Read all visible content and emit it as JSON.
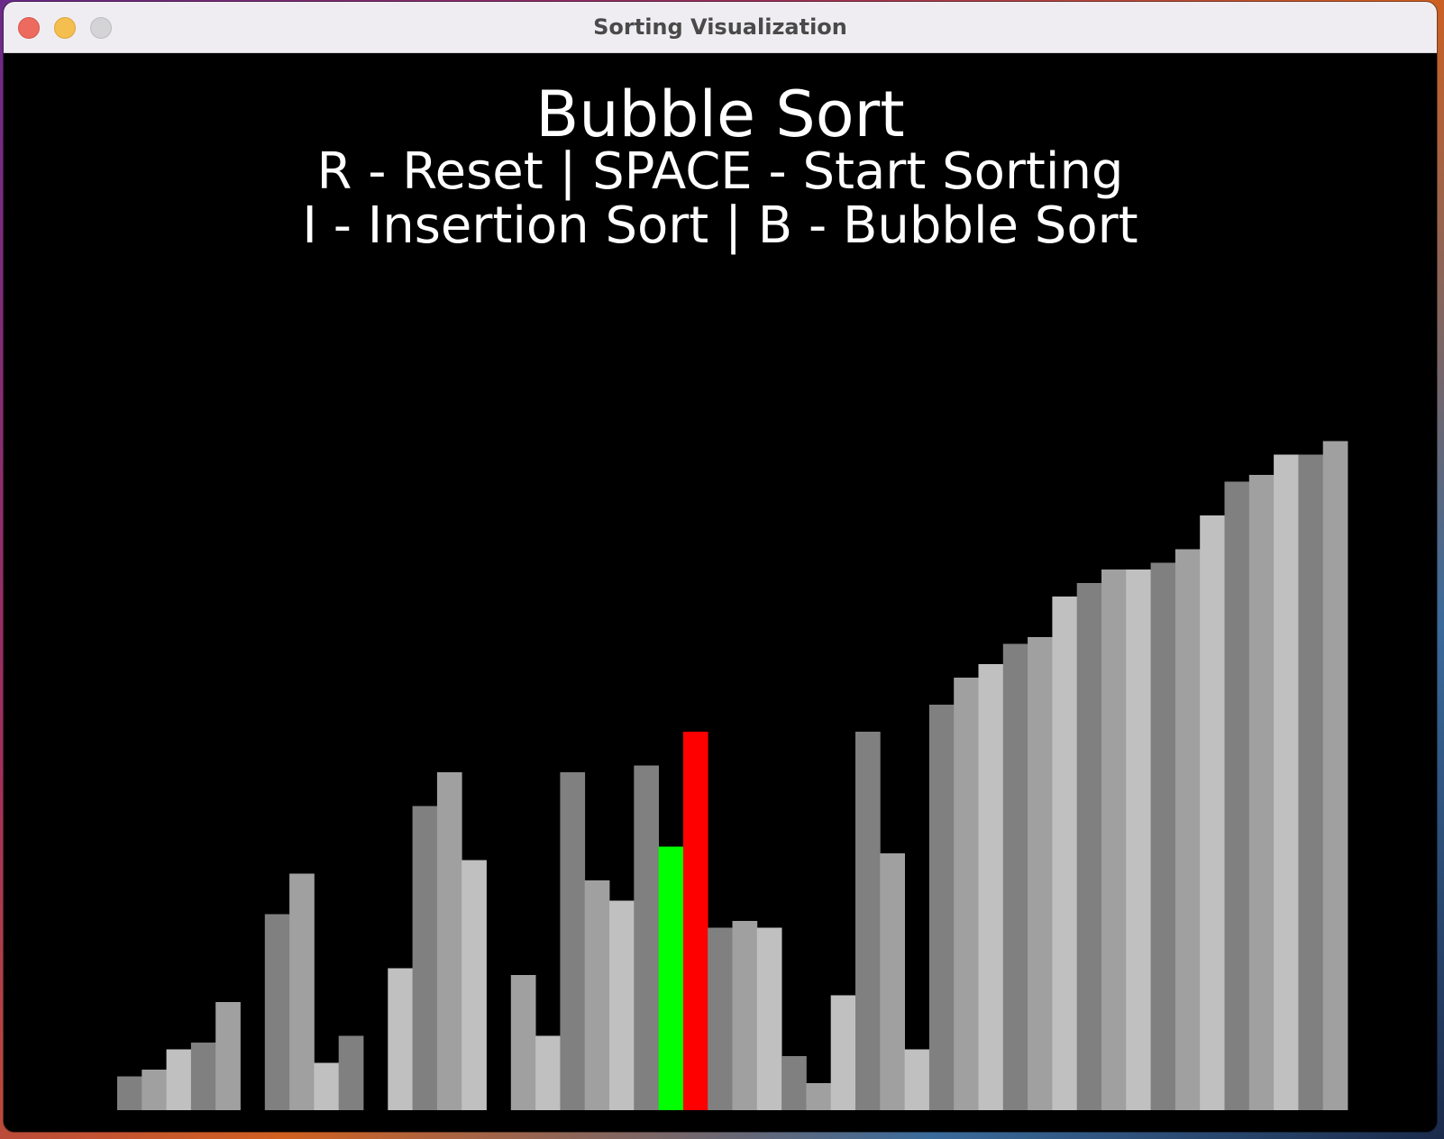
{
  "window": {
    "title": "Sorting Visualization"
  },
  "header": {
    "algorithm_title": "Bubble Sort",
    "help_line_1": "R - Reset | SPACE - Start Sorting",
    "help_line_2": "I - Insertion Sort | B - Bubble Sort"
  },
  "colors": {
    "background": "#000000",
    "bar_shades": [
      "#808080",
      "#a0a0a0",
      "#c0c0c0"
    ],
    "compare_low": "#00ff00",
    "compare_high": "#ff0000"
  },
  "chart_data": {
    "type": "bar",
    "values": [
      5,
      6,
      9,
      10,
      16,
      0,
      29,
      35,
      7,
      11,
      0,
      21,
      45,
      50,
      37,
      0,
      20,
      11,
      50,
      34,
      31,
      51,
      39,
      56,
      27,
      28,
      27,
      8,
      4,
      17,
      56,
      38,
      9,
      60,
      64,
      66,
      69,
      70,
      76,
      78,
      80,
      80,
      81,
      83,
      88,
      93,
      94,
      97,
      97,
      99
    ],
    "ylim": [
      0,
      100
    ],
    "highlight": {
      "green_index": 22,
      "red_index": 23
    }
  }
}
